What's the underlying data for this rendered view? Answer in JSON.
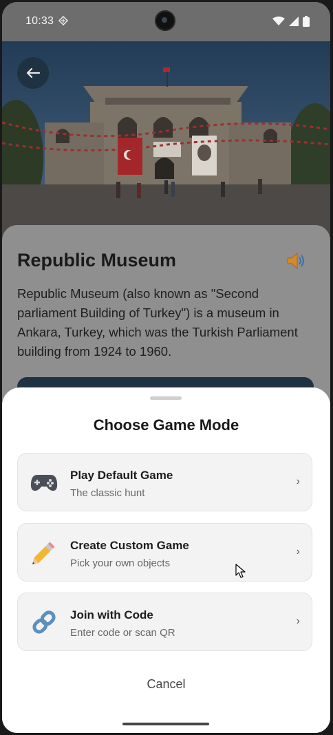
{
  "status_bar": {
    "time": "10:33"
  },
  "hero": {
    "back_icon": "arrow-left-icon"
  },
  "museum": {
    "title": "Republic Museum",
    "speaker_icon": "speaker-icon",
    "description": "Republic Museum (also known as \"Second parliament Building of Turkey\") is a museum in Ankara, Turkey, which was the Turkish Parliament building from 1924 to 1960."
  },
  "sheet": {
    "title": "Choose Game Mode",
    "options": [
      {
        "label": "Play Default Game",
        "subtitle": "The classic hunt",
        "icon": "game-controller-icon"
      },
      {
        "label": "Create Custom Game",
        "subtitle": "Pick your own objects",
        "icon": "pencil-icon"
      },
      {
        "label": "Join with Code",
        "subtitle": "Enter code or scan QR",
        "icon": "link-icon"
      }
    ],
    "chevron": "›",
    "cancel_label": "Cancel"
  },
  "colors": {
    "accent": "#1f3242",
    "scrim": "#8e8e8e",
    "sheet_bg": "#ffffff"
  }
}
